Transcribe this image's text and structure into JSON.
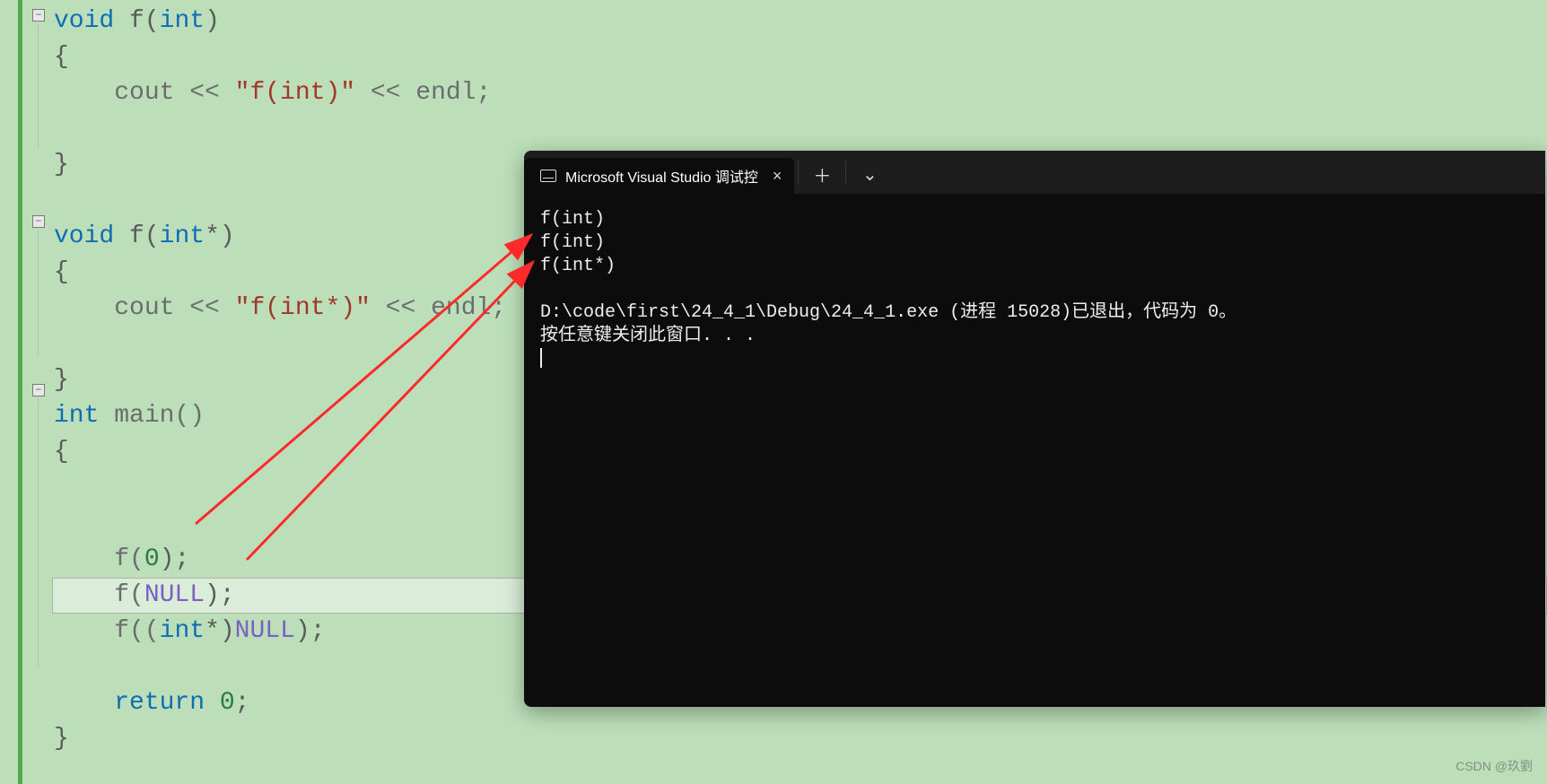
{
  "editor": {
    "lines": {
      "l1_kw_void": "void",
      "l1_rest": " f(",
      "l1_kw_int": "int",
      "l1_rest2": ")",
      "l3_cout": "cout << ",
      "l3_str": "\"f(int)\"",
      "l3_endl": " << endl;",
      "l6_kw_void": "void",
      "l6_rest": " f(",
      "l6_kw_int": "int",
      "l6_rest2": "*)",
      "l8_cout": "cout << ",
      "l8_str": "\"f(int*)\"",
      "l8_endl": " << endl;",
      "l10_kw_int": "int",
      "l10_main": " main()",
      "l13_f": "f(",
      "l13_num": "0",
      "l13_end": ");",
      "l14_f": "f(",
      "l14_null": "NULL",
      "l14_end": ");",
      "l15_f": "f((",
      "l15_kw_int": "int",
      "l15_star": "*)",
      "l15_null": "NULL",
      "l15_end": ");",
      "l17_return": "return",
      "l17_sp": " ",
      "l17_num": "0",
      "l17_end": ";",
      "brace_open": "{",
      "brace_close": "}"
    }
  },
  "console": {
    "tab_title": "Microsoft Visual Studio 调试控",
    "output": [
      "f(int)",
      "f(int)",
      "f(int*)",
      "",
      "D:\\code\\first\\24_4_1\\Debug\\24_4_1.exe (进程 15028)已退出，代码为 0。",
      "按任意键关闭此窗口. . ."
    ]
  },
  "watermark": "CSDN @玖劉"
}
